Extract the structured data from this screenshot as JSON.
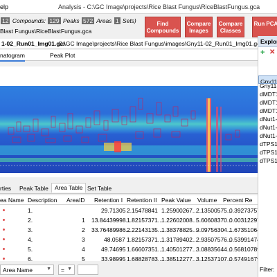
{
  "window": {
    "menu_partial": "elp",
    "title": "Analysis - C:\\GC Image\\projects\\Rice Blast Fungus\\RiceBlastFungus.gca"
  },
  "stats": {
    "count_a": "12",
    "compounds_label": "Compounds:",
    "compounds_count": "129",
    "peaks_label": "Peaks",
    "peaks_count": "572",
    "areas_label": "Areas",
    "sets_count": "1",
    "sets_label": "Sets)"
  },
  "file_label": "Blast Fungus\\RiceBlastFungus.gca",
  "buttons": {
    "find_compounds": "Find Compounds",
    "compare_images": "Compare Images",
    "compare_classes": "Compare Classes",
    "run_pca": "Run PCA"
  },
  "pathbar": {
    "gci_name": "1-02_Run01_Img01.gci",
    "path": "C:\\GC Image\\projects\\Rice Blast Fungus\\images\\Gny11-02_Run01_Img01.gci"
  },
  "view_tabs": {
    "chromatogram": "natogram",
    "peak_plot": "Peak Plot"
  },
  "bottom_tabs": {
    "properties": "rties",
    "peak_table": "Peak Table",
    "area_table": "Area Table",
    "set_table": "Set Table"
  },
  "table": {
    "headers": [
      "ea Name",
      "Description",
      "AreaID",
      "Retention I",
      "Retention II",
      "Peak Value",
      "Volume",
      "Percent Re"
    ],
    "rows": [
      {
        "description": "1.",
        "area_id": "",
        "ret1": "29.71305",
        "ret2": "2.15478841",
        "peak": "1.25900267...",
        "volume": "2.13500575...",
        "pct": "0.39273757"
      },
      {
        "description": "2.",
        "area_id": "1",
        "ret1": "13.84439998...",
        "ret2": "1.82157371...",
        "peak": "1.22602008...",
        "volume": "5.60608370...",
        "pct": "0.00312297"
      },
      {
        "description": "3.",
        "area_id": "2",
        "ret1": "33.76489986...",
        "ret2": "2.22143135...",
        "peak": "1.38378825...",
        "volume": "9.09756304...",
        "pct": "1.67351064"
      },
      {
        "description": "4.",
        "area_id": "3",
        "ret1": "48.0587",
        "ret2": "1.82157371...",
        "peak": "1.31789402...",
        "volume": "2.93507576...",
        "pct": "0.53991474"
      },
      {
        "description": "5.",
        "area_id": "4",
        "ret1": "49.74695",
        "ret2": "1.66607351...",
        "peak": "1.40501277...",
        "volume": "3.08835644...",
        "pct": "0.56810789"
      },
      {
        "description": "6.",
        "area_id": "5",
        "ret1": "33.98995",
        "ret2": "1.68828783...",
        "peak": "1.38512277...",
        "volume": "3.12537107...",
        "pct": "0.57491679"
      }
    ]
  },
  "filter": {
    "field": "Area Name",
    "operator": "=",
    "value": ""
  },
  "explorer": {
    "title": "Explor",
    "items": [
      "Gny11-",
      "Gny11-",
      "Gny11-",
      "dMDT1",
      "dMDT1",
      "dMDT1",
      "dNut1-",
      "dNut1-",
      "dNut1-",
      "dTPS1-",
      "dTPS1-",
      "dTPS1-"
    ],
    "filter_label": "Filter:"
  },
  "icons": {
    "add": "plus-icon",
    "remove": "close-icon",
    "dropdown": "chevron-down-icon"
  },
  "colors": {
    "accent_button": "#d9534f",
    "selected_tab": "#3b7bd6",
    "panel_header": "#dce6f2"
  }
}
